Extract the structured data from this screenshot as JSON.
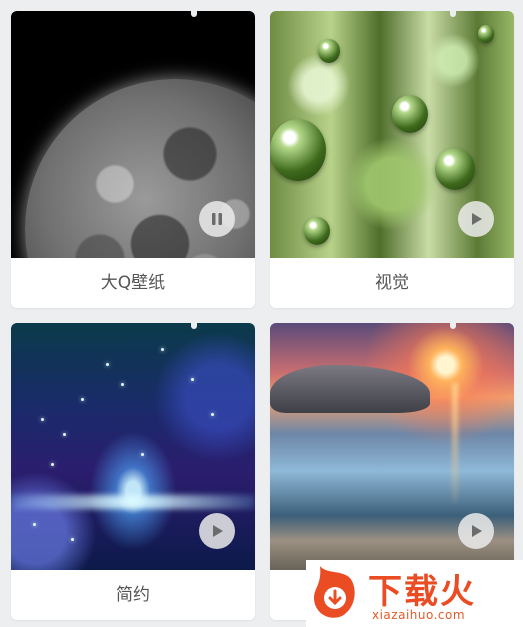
{
  "wallpapers": [
    {
      "title": "大Q壁纸",
      "state": "paused",
      "control_icon": "pause-icon"
    },
    {
      "title": "视觉",
      "state": "stopped",
      "control_icon": "play-icon"
    },
    {
      "title": "简约",
      "state": "stopped",
      "control_icon": "play-icon"
    },
    {
      "title": "",
      "state": "stopped",
      "control_icon": "play-icon"
    }
  ],
  "watermark": {
    "brand": "下载火",
    "url": "xiazaihuo.com"
  },
  "colors": {
    "background": "#eceef0",
    "card": "#ffffff",
    "label_text": "#555555",
    "watermark_accent": "#ea4c24"
  }
}
